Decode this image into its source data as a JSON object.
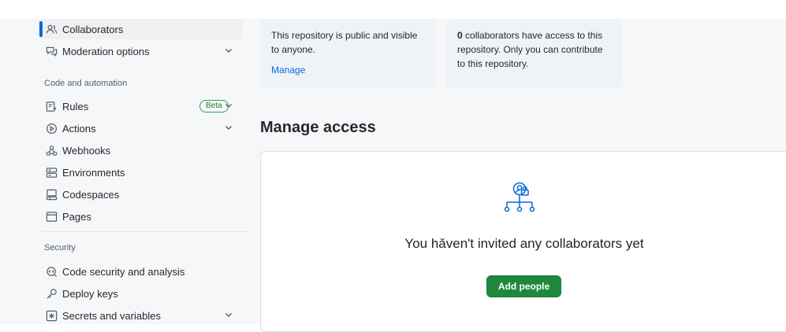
{
  "sidebar": {
    "items_top": [
      {
        "label": "Collaborators",
        "icon": "people-icon"
      },
      {
        "label": "Moderation options",
        "icon": "comment-discussion-icon"
      }
    ],
    "sections": [
      {
        "label": "Code and automation",
        "items": [
          {
            "label": "Rules",
            "icon": "rules-icon",
            "badge": "Beta"
          },
          {
            "label": "Actions",
            "icon": "play-icon"
          },
          {
            "label": "Webhooks",
            "icon": "webhook-icon"
          },
          {
            "label": "Environments",
            "icon": "server-icon"
          },
          {
            "label": "Codespaces",
            "icon": "codespaces-icon"
          },
          {
            "label": "Pages",
            "icon": "browser-icon"
          }
        ]
      },
      {
        "label": "Security",
        "items": [
          {
            "label": "Code security and analysis",
            "icon": "codescan-icon"
          },
          {
            "label": "Deploy keys",
            "icon": "key-icon"
          },
          {
            "label": "Secrets and variables",
            "icon": "asterisk-icon"
          }
        ]
      }
    ]
  },
  "visibility_card": {
    "text": "This repository is public and visible to anyone.",
    "link": "Manage"
  },
  "collaborators_card": {
    "count": "0",
    "text": " collaborators have access to this repository. Only you can contribute to this repository."
  },
  "manage_access": {
    "title": "Manage access",
    "empty_message": "You hǎven't invited any collaborators yet",
    "add_button": "Add people"
  },
  "colors": {
    "accent": "#0969da",
    "primary_button": "#1f883d",
    "beta_badge": "#1a7f37"
  }
}
